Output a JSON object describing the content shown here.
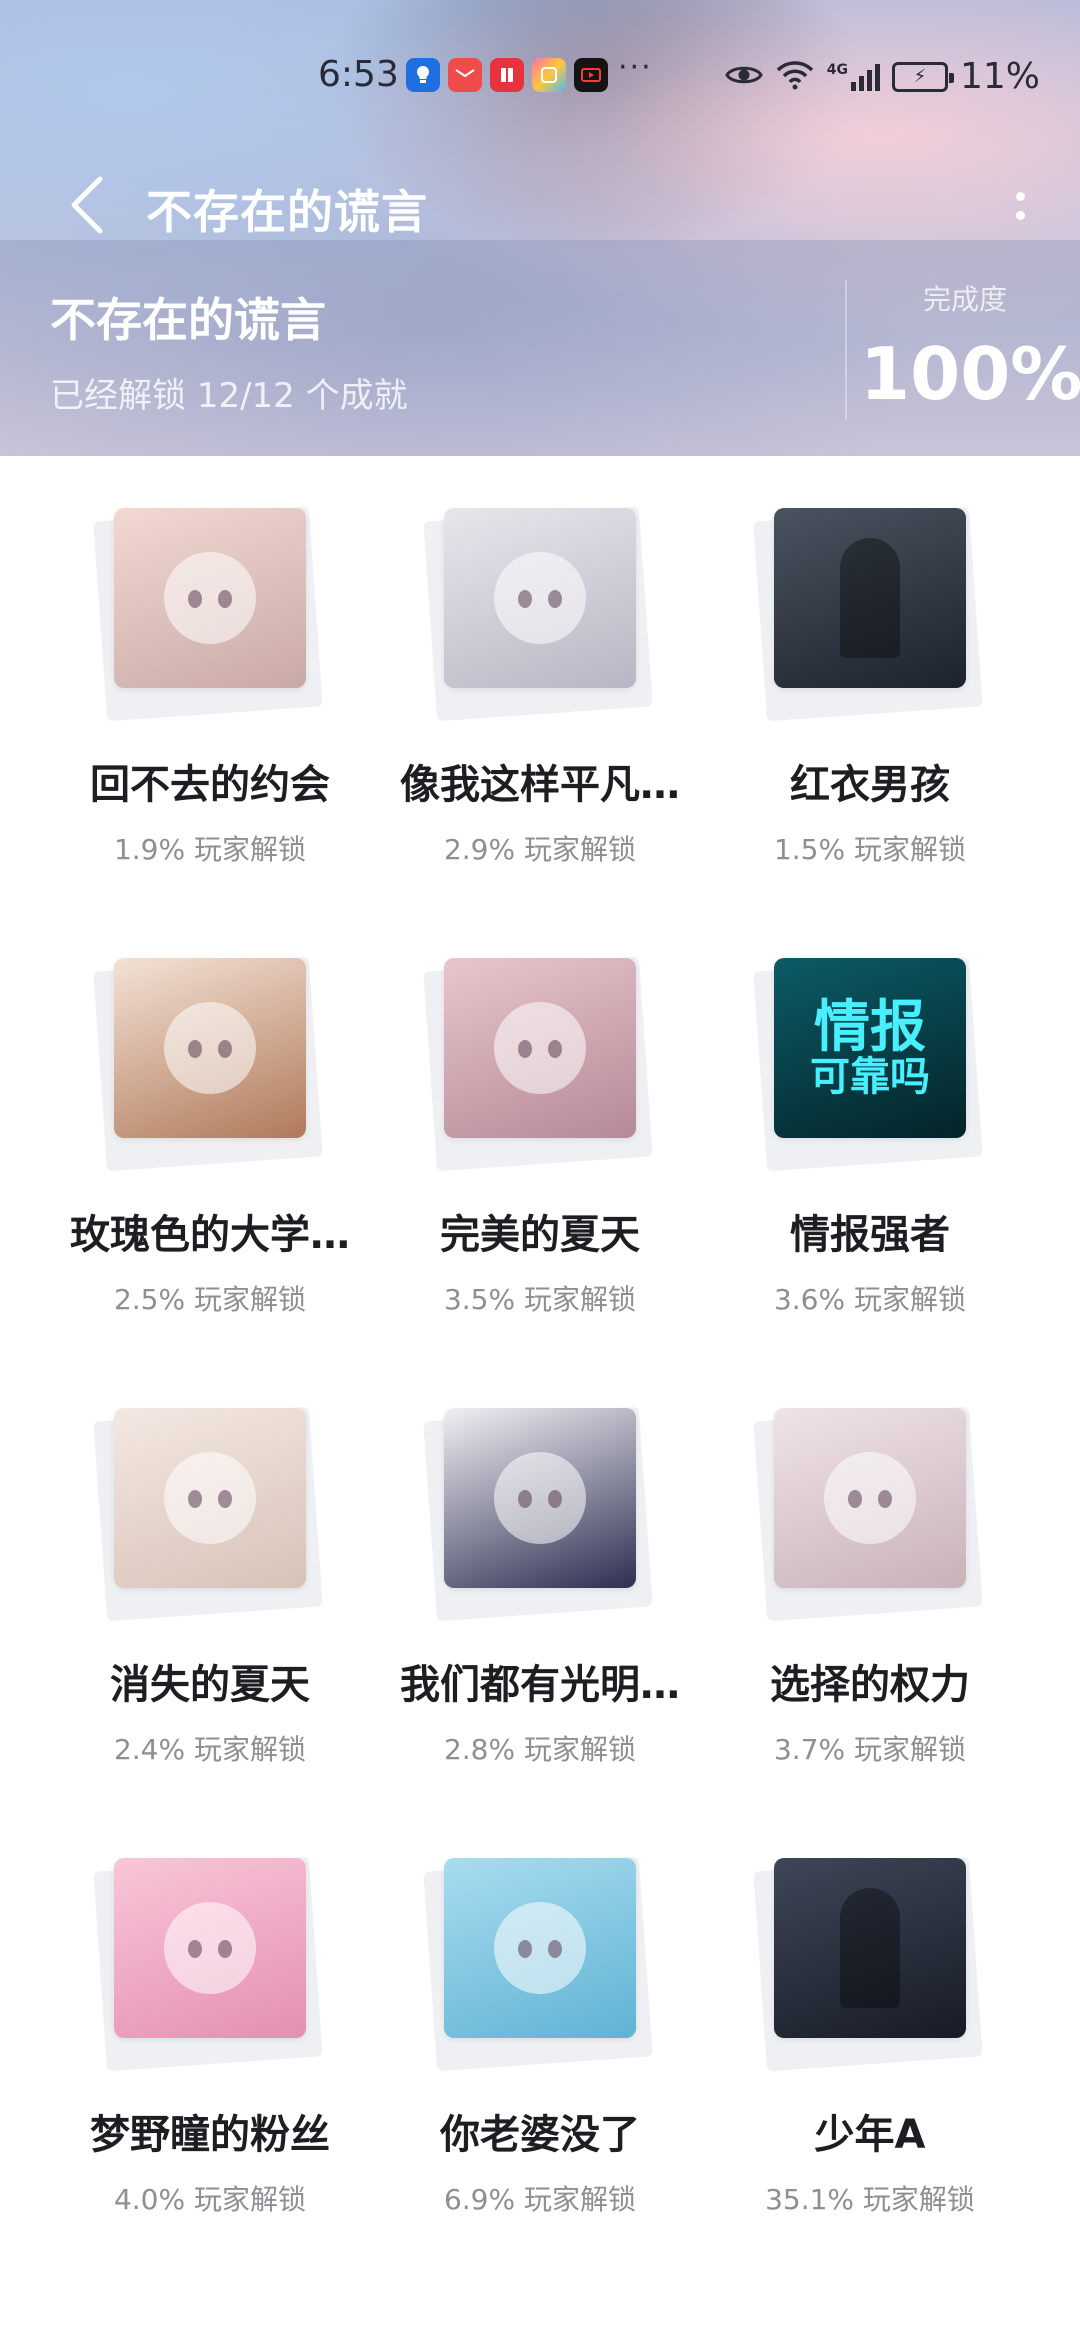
{
  "status_bar": {
    "time": "6:53",
    "notification_icons": [
      "lightbulb-app-icon",
      "huawei-mail-icon",
      "red-book-icon",
      "colorful-app-icon",
      "video-app-icon"
    ],
    "more_indicator": "···",
    "network": "4G",
    "battery_percent": "11%"
  },
  "toolbar": {
    "title": "不存在的谎言"
  },
  "summary": {
    "game_name": "不存在的谎言",
    "unlock_text": "已经解锁 12/12 个成就",
    "completion_label": "完成度",
    "completion_value": "100%"
  },
  "achievements": [
    {
      "name": "回不去的约会",
      "rate": "1.9% 玩家解锁",
      "colors": [
        "#f2d9d2",
        "#c9a9a6"
      ],
      "style": "face"
    },
    {
      "name": "像我这样平凡…",
      "rate": "2.9% 玩家解锁",
      "colors": [
        "#e8e6ec",
        "#b9b5c4"
      ],
      "style": "face"
    },
    {
      "name": "红衣男孩",
      "rate": "1.5% 玩家解锁",
      "colors": [
        "#4a5360",
        "#1d232c"
      ],
      "style": "dark"
    },
    {
      "name": "玫瑰色的大学…",
      "rate": "2.5% 玩家解锁",
      "colors": [
        "#f4e2d6",
        "#b07a5a"
      ],
      "style": "face"
    },
    {
      "name": "完美的夏天",
      "rate": "3.5% 玩家解锁",
      "colors": [
        "#e8c6cc",
        "#b58a96"
      ],
      "style": "face"
    },
    {
      "name": "情报强者",
      "rate": "3.6% 玩家解锁",
      "colors": [
        "#0b5b66",
        "#042329"
      ],
      "style": "text",
      "badge_line1": "情报",
      "badge_line2": "可靠吗"
    },
    {
      "name": "消失的夏天",
      "rate": "2.4% 玩家解锁",
      "colors": [
        "#f3e8e2",
        "#d8c2b8"
      ],
      "style": "face"
    },
    {
      "name": "我们都有光明…",
      "rate": "2.8% 玩家解锁",
      "colors": [
        "#f0f0f4",
        "#2e2f52"
      ],
      "style": "face"
    },
    {
      "name": "选择的权力",
      "rate": "3.7% 玩家解锁",
      "colors": [
        "#efe3e6",
        "#c8b2b8"
      ],
      "style": "face"
    },
    {
      "name": "梦野瞳的粉丝",
      "rate": "4.0% 玩家解锁",
      "colors": [
        "#f9c6d8",
        "#e48fb2"
      ],
      "style": "face"
    },
    {
      "name": "你老婆没了",
      "rate": "6.9% 玩家解锁",
      "colors": [
        "#a9dcef",
        "#5fb3d4"
      ],
      "style": "face"
    },
    {
      "name": "少年A",
      "rate": "35.1% 玩家解锁",
      "colors": [
        "#3e4658",
        "#171b25"
      ],
      "style": "dark"
    }
  ]
}
